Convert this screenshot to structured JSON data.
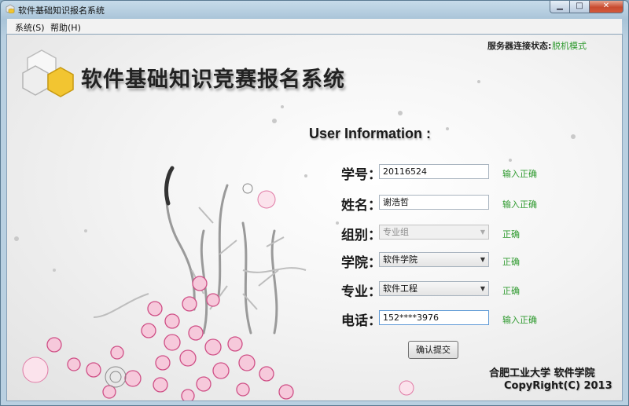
{
  "window": {
    "title": "软件基础知识报名系统"
  },
  "menu": {
    "system": "系统(S)",
    "help": "帮助(H)"
  },
  "header": {
    "app_title": "软件基础知识竞赛报名系统"
  },
  "server": {
    "label": "服务器连接状态:",
    "value": "脱机模式"
  },
  "form": {
    "section_title": "User Information :",
    "student_id": {
      "label": "学号：",
      "value": "20116524",
      "status": "输入正确"
    },
    "name": {
      "label": "姓名：",
      "value": "谢浩哲",
      "status": "输入正确"
    },
    "group": {
      "label": "组别：",
      "value": "专业组",
      "status": "正确"
    },
    "college": {
      "label": "学院：",
      "value": "软件学院",
      "status": "正确"
    },
    "major": {
      "label": "专业：",
      "value": "软件工程",
      "status": "正确"
    },
    "phone": {
      "label": "电话：",
      "value": "152****3976",
      "status": "输入正确"
    },
    "submit_label": "确认提交"
  },
  "footer": {
    "line1": "合肥工业大学 软件学院",
    "line2": "CopyRight(C) 2013"
  },
  "colors": {
    "status_ok": "#2f9a2f",
    "logo_yellow": "#f2c531"
  },
  "icons": {
    "minimize": "minimize-icon",
    "maximize": "maximize-icon",
    "close": "close-icon",
    "dropdown": "chevron-down-icon"
  }
}
